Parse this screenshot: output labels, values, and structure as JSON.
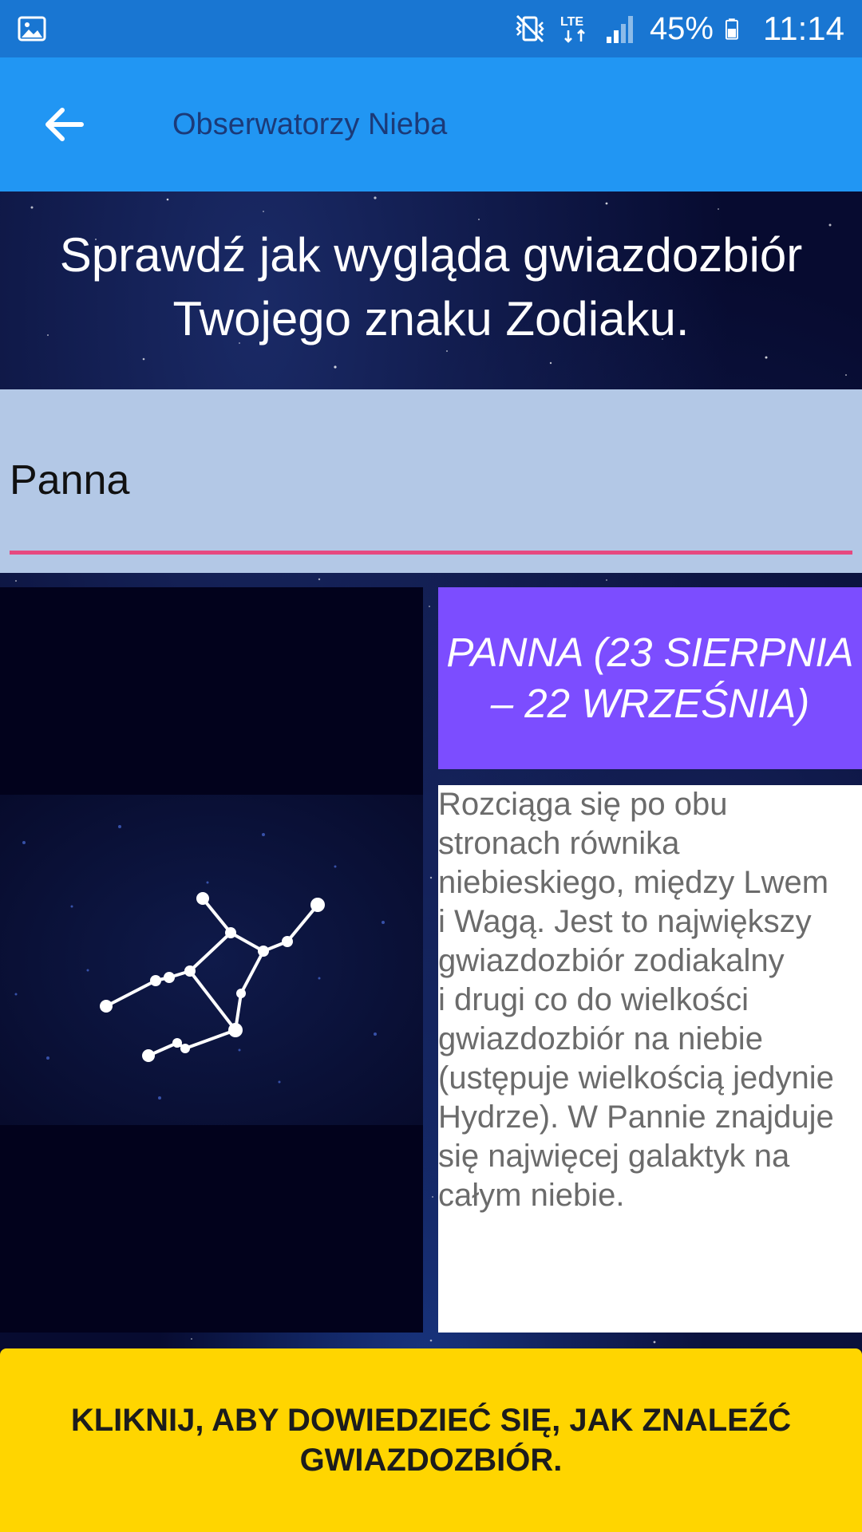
{
  "status_bar": {
    "battery": "45%",
    "time": "11:14",
    "icons": [
      "image-icon",
      "vibrate-mute-icon",
      "lte-icon",
      "signal-icon",
      "battery-icon"
    ]
  },
  "toolbar": {
    "title": "Obserwatorzy Nieba",
    "back_icon": "arrow-back-icon"
  },
  "headline": {
    "line1": "Sprawdź jak wygląda gwiazdozbiór",
    "line2": "Twojego znaku Zodiaku."
  },
  "sign_selector": {
    "value": "Panna"
  },
  "sign_card": {
    "title_line1": "PANNA (23 SIERPNIA",
    "title_line2": "– 22 WRZEŚNIA)",
    "description": "Rozciąga się po obu\nstronach równika\nniebieskiego, między Lwem\ni Wagą. Jest to największy\ngwiazdozbiór zodiakalny\ni drugi co do wielkości\ngwiazdozbiór na niebie\n(ustępuje wielkością jedynie\nHydrze). W Pannie znajduje\nsię najwięcej galaktyk na\ncałym niebie."
  },
  "cta": {
    "line1": "KLIKNIJ, ABY DOWIEDZIEĆ SIĘ, JAK ZNALEŹĆ",
    "line2": "GWIAZDOZBIÓR."
  },
  "colors": {
    "status_bar": "#1976d2",
    "toolbar": "#2196f3",
    "toolbar_title": "#1b3a78",
    "field_bg": "#b3c8e6",
    "field_underline": "#e64980",
    "title_box": "#7c4dff",
    "cta": "#ffd500"
  }
}
